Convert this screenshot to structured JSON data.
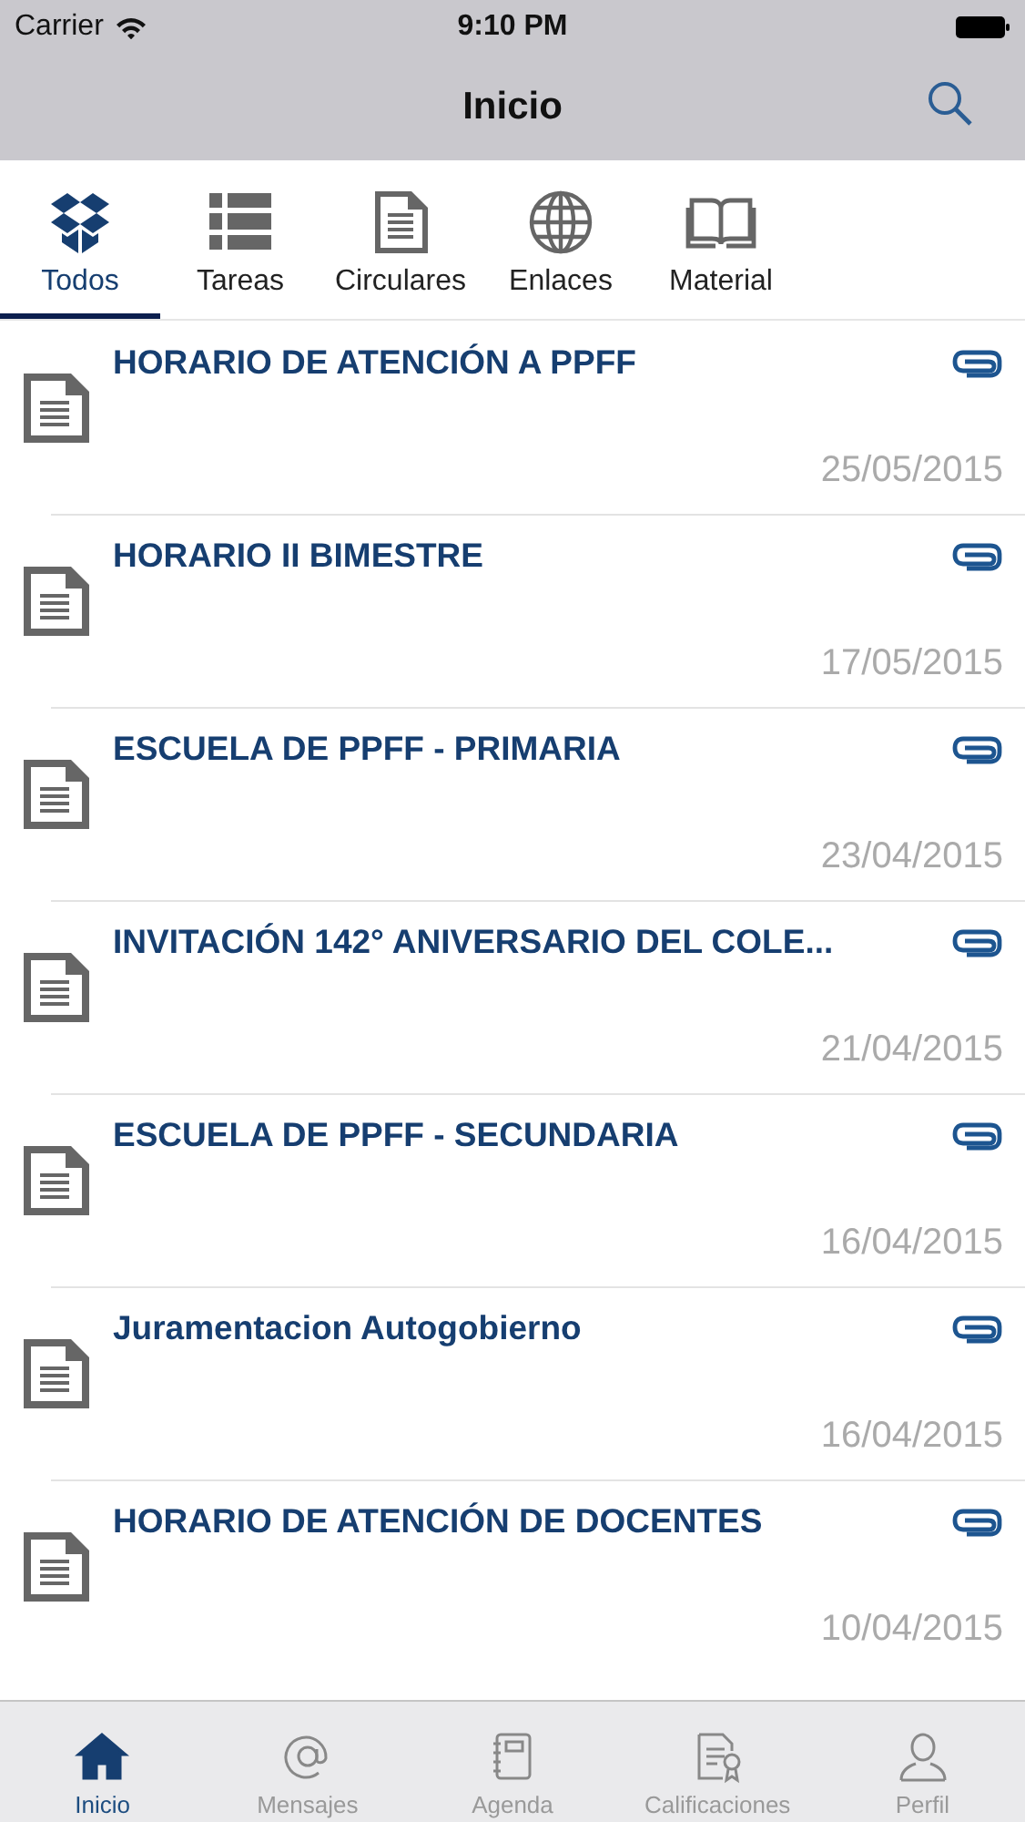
{
  "status_bar": {
    "carrier": "Carrier",
    "time": "9:10 PM"
  },
  "nav": {
    "title": "Inicio"
  },
  "categories": [
    {
      "label": "Todos",
      "kind": "box",
      "selected": true
    },
    {
      "label": "Tareas",
      "kind": "list",
      "selected": false
    },
    {
      "label": "Circulares",
      "kind": "doc",
      "selected": false
    },
    {
      "label": "Enlaces",
      "kind": "globe",
      "selected": false
    },
    {
      "label": "Material",
      "kind": "book",
      "selected": false
    }
  ],
  "items": [
    {
      "title": "HORARIO DE ATENCIÓN A PPFF",
      "date": "25/05/2015",
      "attachment": true
    },
    {
      "title": "HORARIO II BIMESTRE",
      "date": "17/05/2015",
      "attachment": true
    },
    {
      "title": "ESCUELA DE PPFF - PRIMARIA",
      "date": "23/04/2015",
      "attachment": true
    },
    {
      "title": "INVITACIÓN 142° ANIVERSARIO DEL COLE...",
      "date": "21/04/2015",
      "attachment": true
    },
    {
      "title": "ESCUELA DE PPFF - SECUNDARIA",
      "date": "16/04/2015",
      "attachment": true
    },
    {
      "title": "Juramentacion Autogobierno",
      "date": "16/04/2015",
      "attachment": true
    },
    {
      "title": "HORARIO DE ATENCIÓN DE DOCENTES",
      "date": "10/04/2015",
      "attachment": true
    }
  ],
  "tab_bar": [
    {
      "label": "Inicio",
      "kind": "home",
      "selected": true
    },
    {
      "label": "Mensajes",
      "kind": "at",
      "selected": false
    },
    {
      "label": "Agenda",
      "kind": "notebook",
      "selected": false
    },
    {
      "label": "Calificaciones",
      "kind": "certificate",
      "selected": false
    },
    {
      "label": "Perfil",
      "kind": "person",
      "selected": false
    }
  ]
}
